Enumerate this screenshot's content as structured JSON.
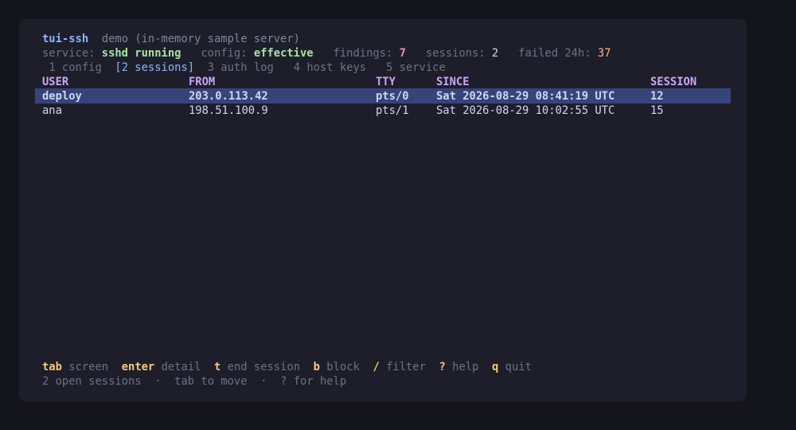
{
  "header": {
    "app_name": "tui-ssh",
    "subtitle": "demo (in-memory sample server)"
  },
  "status": {
    "service_label": "service:",
    "service_value": "sshd running",
    "config_label": "config:",
    "config_value": "effective",
    "findings_label": "findings:",
    "findings_value": "7",
    "sessions_label": "sessions:",
    "sessions_value": "2",
    "failed_label": "failed 24h:",
    "failed_value": "37"
  },
  "tabs": [
    {
      "label": "1 config",
      "selected": false
    },
    {
      "label": "[2 sessions]",
      "selected": true
    },
    {
      "label": "3 auth log",
      "selected": false
    },
    {
      "label": "4 host keys",
      "selected": false
    },
    {
      "label": "5 service",
      "selected": false
    }
  ],
  "table": {
    "columns": [
      "USER",
      "FROM",
      "TTY",
      "SINCE",
      "SESSION"
    ],
    "rows": [
      {
        "user": "deploy",
        "from": "203.0.113.42",
        "tty": "pts/0",
        "since": "Sat 2026-08-29 08:41:19 UTC",
        "session": "12",
        "selected": true
      },
      {
        "user": "ana",
        "from": "198.51.100.9",
        "tty": "pts/1",
        "since": "Sat 2026-08-29 10:02:55 UTC",
        "session": "15",
        "selected": false
      }
    ]
  },
  "keys": [
    {
      "key": "tab",
      "action": "screen"
    },
    {
      "key": "enter",
      "action": "detail"
    },
    {
      "key": "t",
      "action": "end session"
    },
    {
      "key": "b",
      "action": "block"
    },
    {
      "key": "/",
      "action": "filter"
    },
    {
      "key": "?",
      "action": "help"
    },
    {
      "key": "q",
      "action": "quit"
    }
  ],
  "footer": {
    "open_sessions": "2 open sessions",
    "sep": "·",
    "tab_hint": "tab to move",
    "help_hint": "? for help"
  },
  "colors": {
    "background": "#1e1e2b",
    "selection": "#36447a",
    "accent": "#89b4fa",
    "header_text": "#cba6f7",
    "ok": "#a6e3a1",
    "warn": "#f38ba8",
    "notice": "#fab387"
  }
}
